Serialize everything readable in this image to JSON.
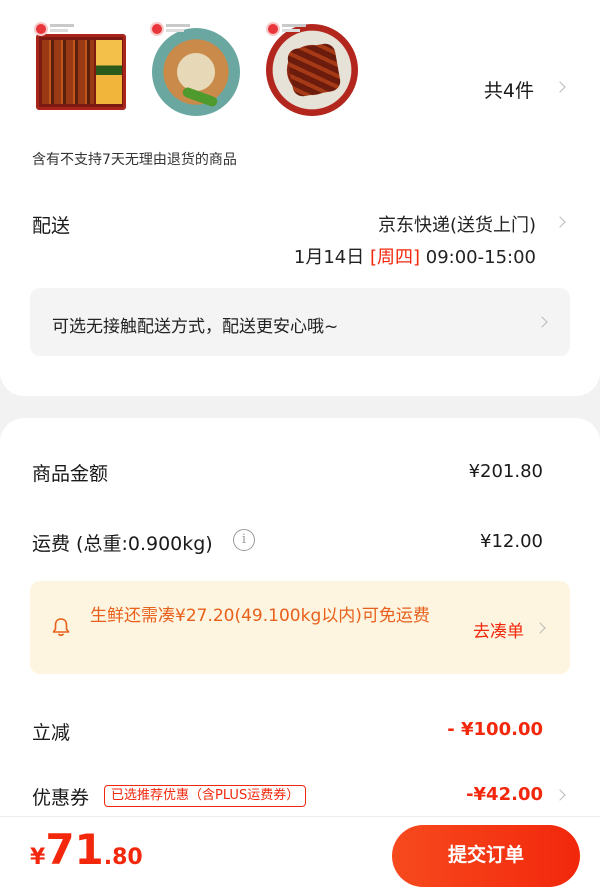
{
  "goods": {
    "count_label": "共4件",
    "items": [
      {
        "icon": "eel-bento-thumbnail"
      },
      {
        "icon": "chicken-plate-thumbnail"
      },
      {
        "icon": "eel-rice-bowl-thumbnail"
      }
    ]
  },
  "notice": "含有不支持7天无理由退货的商品",
  "shipping": {
    "label": "配送",
    "method": "京东快递(送货上门)",
    "date": "1月14日",
    "weekday": "[周四]",
    "time": "09:00-15:00"
  },
  "contactless": {
    "text": "可选无接触配送方式，配送更安心哦~"
  },
  "summary": {
    "goods_amount_label": "商品金额",
    "goods_amount_value": "¥201.80",
    "freight_label": "运费 (总重:0.900kg)",
    "freight_value": "¥12.00",
    "fresh_notice": "生鲜还需凑¥27.20(49.100kg以内)可免运费",
    "fresh_link": "去凑单",
    "discount_label": "立减",
    "discount_value": "- ¥100.00",
    "coupon_label": "优惠券",
    "coupon_tag": "已选推荐优惠（含PLUS运费券）",
    "coupon_value": "-¥42.00"
  },
  "footer": {
    "currency": "¥",
    "total_int": "71",
    "total_dec": ".80",
    "submit_label": "提交订单"
  },
  "colors": {
    "accent": "#f2270c",
    "fresh_bg": "#fdf5df",
    "fresh_text": "#e8601c"
  }
}
